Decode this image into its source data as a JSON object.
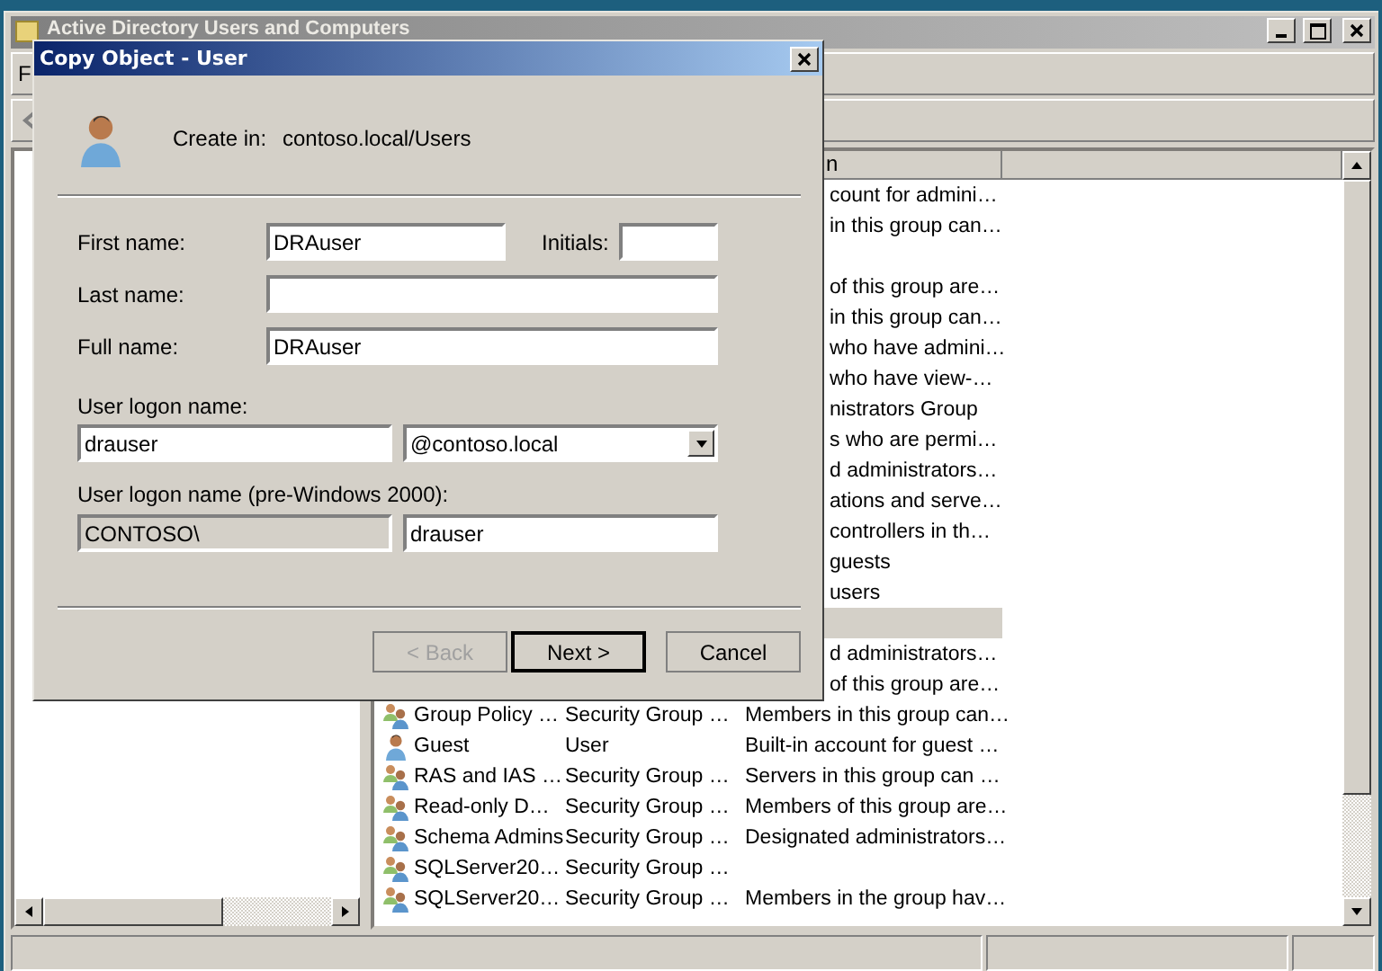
{
  "main_window": {
    "title": "Active Directory Users and Computers",
    "menu": [
      "F"
    ]
  },
  "list": {
    "columns": [
      {
        "label": "n"
      }
    ],
    "rows": [
      {
        "kind": "partial",
        "description": "count for admini…",
        "selected": false
      },
      {
        "kind": "partial",
        "description": "in this group can…",
        "selected": false
      },
      {
        "kind": "partial",
        "selected": false
      },
      {
        "kind": "partial",
        "description": "of this group are…",
        "selected": false
      },
      {
        "kind": "partial",
        "description": "in this group can…",
        "selected": false
      },
      {
        "kind": "partial",
        "description": "who have admini…",
        "selected": false
      },
      {
        "kind": "partial",
        "description": "who have view-…",
        "selected": false
      },
      {
        "kind": "partial",
        "description": "nistrators Group",
        "selected": false
      },
      {
        "kind": "partial",
        "description": "s who are permi…",
        "selected": false
      },
      {
        "kind": "partial",
        "description": "d administrators…",
        "selected": false
      },
      {
        "kind": "partial",
        "description": "ations and serve…",
        "selected": false
      },
      {
        "kind": "partial",
        "description": "controllers in th…",
        "selected": false
      },
      {
        "kind": "partial",
        "description": "guests",
        "selected": false
      },
      {
        "kind": "partial",
        "description": "users",
        "selected": false
      },
      {
        "kind": "partial",
        "selected": true
      },
      {
        "kind": "partial",
        "description": "d administrators…",
        "selected": false
      },
      {
        "kind": "partial",
        "description": "of this group are…",
        "selected": false
      },
      {
        "kind": "group",
        "name": "Group Policy …",
        "type": "Security Group …",
        "description": "Members in this group can…",
        "selected": false
      },
      {
        "kind": "user",
        "name": "Guest",
        "type": "User",
        "description": "Built-in account for guest …",
        "selected": false
      },
      {
        "kind": "group",
        "name": "RAS and IAS …",
        "type": "Security Group …",
        "description": "Servers in this group can …",
        "selected": false
      },
      {
        "kind": "group",
        "name": "Read-only D…",
        "type": "Security Group …",
        "description": "Members of this group are…",
        "selected": false
      },
      {
        "kind": "group",
        "name": "Schema Admins",
        "type": "Security Group …",
        "description": "Designated administrators…",
        "selected": false
      },
      {
        "kind": "group",
        "name": "SQLServer20…",
        "type": "Security Group …",
        "selected": false
      },
      {
        "kind": "group",
        "name": "SQLServer20…",
        "type": "Security Group …",
        "description": "Members in the group hav…",
        "selected": false
      }
    ]
  },
  "dialog": {
    "title": "Copy Object - User",
    "create_in_label": "Create in:",
    "create_in_value": "contoso.local/Users",
    "first_name": {
      "label": "First name:",
      "value": "DRAuser"
    },
    "initials": {
      "label": "Initials:"
    },
    "last_name": {
      "label": "Last name:"
    },
    "full_name": {
      "label": "Full name:",
      "value": "DRAuser"
    },
    "logon": {
      "label": "User logon name:",
      "value": "drauser",
      "suffix": "@contoso.local"
    },
    "pre2000": {
      "label": "User logon name (pre-Windows 2000):",
      "domain": "CONTOSO\\",
      "domain_disabled": true,
      "value": "drauser"
    },
    "buttons": [
      {
        "label": "< Back",
        "disabled": true,
        "default": false
      },
      {
        "label": "Next >",
        "disabled": false,
        "default": true
      },
      {
        "label": "Cancel",
        "disabled": false,
        "default": false
      }
    ]
  }
}
